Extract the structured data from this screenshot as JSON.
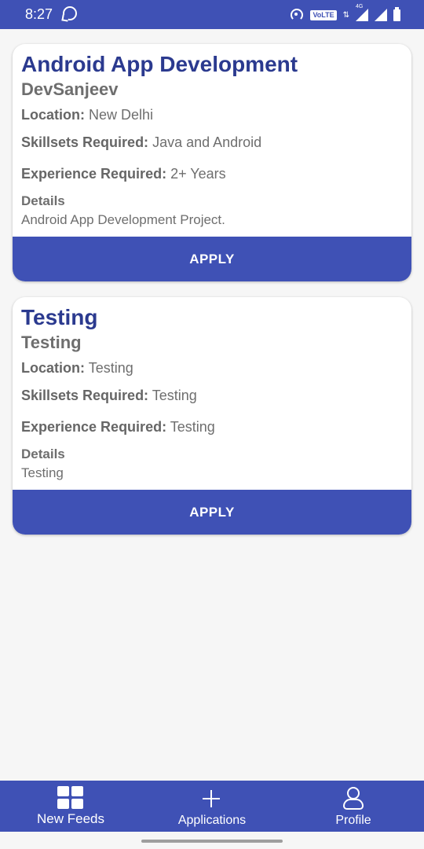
{
  "status_bar": {
    "time": "8:27",
    "volte": "VoLTE",
    "network": "4G",
    "icons": [
      "whatsapp-icon",
      "hotspot-icon",
      "signal-icon",
      "battery-icon"
    ]
  },
  "colors": {
    "primary": "#3f51b5",
    "title": "#2b3a8f",
    "text": "#6e6e6e",
    "background": "#f6f6f6"
  },
  "cards": [
    {
      "title": "Android App Development",
      "company": "DevSanjeev",
      "location_label": "Location:",
      "location": "New Delhi",
      "skills_label": "Skillsets Required:",
      "skills": "Java and Android",
      "experience_label": "Experience Required:",
      "experience": "2+ Years",
      "details_label": "Details",
      "details": "Android App Development Project.",
      "apply_label": "APPLY"
    },
    {
      "title": "Testing",
      "company": "Testing",
      "location_label": "Location:",
      "location": "Testing",
      "skills_label": "Skillsets Required:",
      "skills": "Testing",
      "experience_label": "Experience Required:",
      "experience": "Testing",
      "details_label": "Details",
      "details": "Testing",
      "apply_label": "APPLY"
    }
  ],
  "bottom_nav": {
    "items": [
      {
        "label": "New Feeds",
        "icon": "grid-icon"
      },
      {
        "label": "Applications",
        "icon": "plus-icon"
      },
      {
        "label": "Profile",
        "icon": "person-icon"
      }
    ]
  }
}
